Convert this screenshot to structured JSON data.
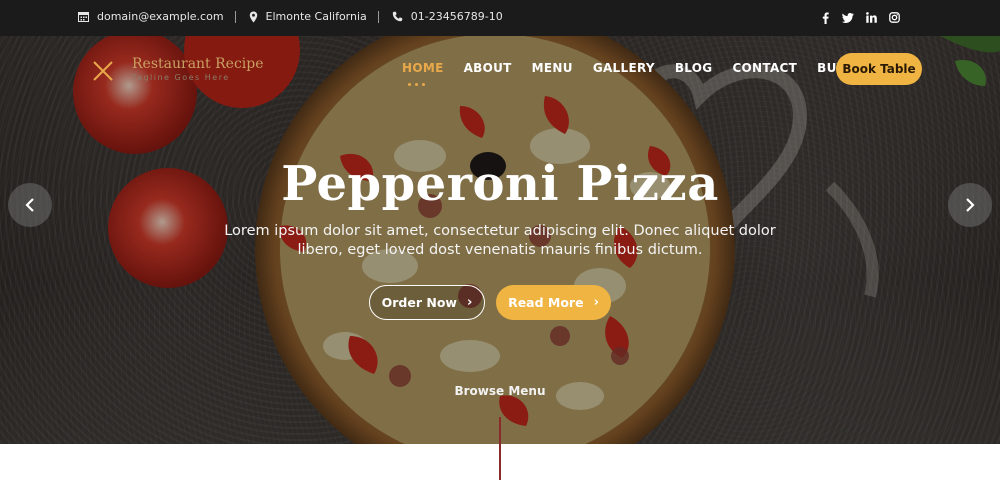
{
  "topbar": {
    "email": "domain@example.com",
    "location": "Elmonte California",
    "phone": "01-23456789-10",
    "email_icon": "calendar-icon",
    "location_icon": "map-pin-icon",
    "phone_icon": "phone-icon",
    "social": [
      "facebook-icon",
      "twitter-icon",
      "linkedin-icon",
      "instagram-icon"
    ]
  },
  "brand": {
    "name": "Restaurant Recipe",
    "tagline": "Tagline Goes Here",
    "logo_icon": "crossed-utensils-icon",
    "accent": "#f0b443",
    "logo_color": "#c9a062"
  },
  "nav": {
    "items": [
      {
        "label": "HOME",
        "active": true
      },
      {
        "label": "ABOUT"
      },
      {
        "label": "MENU"
      },
      {
        "label": "GALLERY"
      },
      {
        "label": "BLOG"
      },
      {
        "label": "CONTACT"
      },
      {
        "label": "BUY PRO"
      }
    ],
    "book_label": "Book Table"
  },
  "hero": {
    "title": "Pepperoni Pizza",
    "text": "Lorem ipsum dolor sit amet, consectetur adipiscing elit. Donec aliquet dolor libero, eget loved dost venenatis mauris finibus dictum.",
    "order_label": "Order Now",
    "read_label": "Read More",
    "browse_label": "Browse Menu",
    "prev_icon": "chevron-left-icon",
    "next_icon": "chevron-right-icon"
  }
}
